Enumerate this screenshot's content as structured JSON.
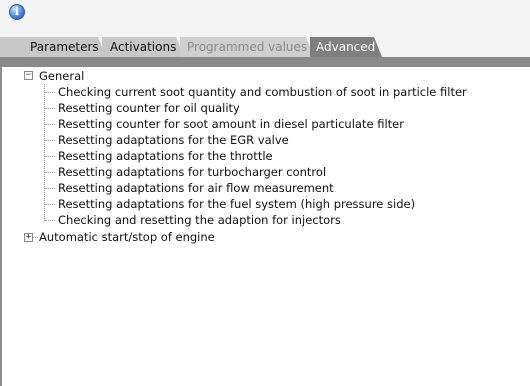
{
  "toolbar": {
    "info_icon": "info-icon"
  },
  "tabs": [
    {
      "label": "Parameters",
      "state": "normal"
    },
    {
      "label": "Activations",
      "state": "normal"
    },
    {
      "label": "Programmed values",
      "state": "disabled"
    },
    {
      "label": "Advanced",
      "state": "active"
    }
  ],
  "tree": {
    "general": {
      "label": "General",
      "expanded": true,
      "children": [
        "Checking current soot quantity and combustion of soot in particle filter",
        "Resetting counter for oil quality",
        "Resetting counter for soot amount in diesel particulate filter",
        "Resetting adaptations for the EGR valve",
        "Resetting adaptations for the throttle",
        "Resetting adaptations for turbocharger control",
        "Resetting adaptations for air flow measurement",
        "Resetting adaptations for the fuel system (high pressure side)",
        "Checking and resetting the adaption for injectors"
      ]
    },
    "automatic": {
      "label": "Automatic start/stop of engine",
      "expanded": false
    }
  },
  "colors": {
    "active_tab": "#7f7f7f",
    "inactive_tab": "#c8c8c8",
    "strip": "#8a8a8a"
  }
}
